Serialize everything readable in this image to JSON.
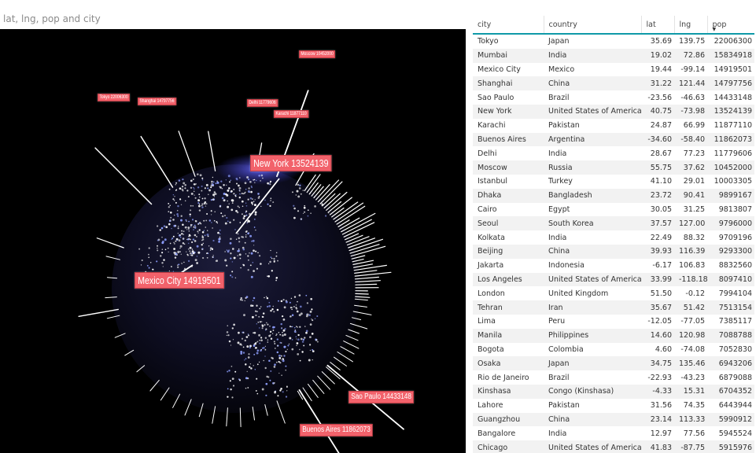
{
  "visual": {
    "title": "lat, lng, pop and city"
  },
  "globe": {
    "labels": [
      {
        "text": "Moscow 10452000",
        "size": "small"
      },
      {
        "text": "Tokyo 22006300",
        "size": "small"
      },
      {
        "text": "Shanghai 14797756",
        "size": "small"
      },
      {
        "text": "Delhi 11779606",
        "size": "small"
      },
      {
        "text": "Karachi 11877110",
        "size": "small"
      },
      {
        "text": "New York 13524139",
        "size": "large"
      },
      {
        "text": "Mexico City 14919501",
        "size": "large"
      },
      {
        "text": "Sao Paulo 14433148",
        "size": "medium"
      },
      {
        "text": "Buenos Aires 11862073",
        "size": "medium"
      }
    ]
  },
  "table": {
    "columns": [
      "city",
      "country",
      "lat",
      "lng",
      "pop"
    ],
    "sorted_column": "pop",
    "rows": [
      [
        "Tokyo",
        "Japan",
        "35.69",
        "139.75",
        "22006300"
      ],
      [
        "Mumbai",
        "India",
        "19.02",
        "72.86",
        "15834918"
      ],
      [
        "Mexico City",
        "Mexico",
        "19.44",
        "-99.14",
        "14919501"
      ],
      [
        "Shanghai",
        "China",
        "31.22",
        "121.44",
        "14797756"
      ],
      [
        "Sao Paulo",
        "Brazil",
        "-23.56",
        "-46.63",
        "14433148"
      ],
      [
        "New York",
        "United States of America",
        "40.75",
        "-73.98",
        "13524139"
      ],
      [
        "Karachi",
        "Pakistan",
        "24.87",
        "66.99",
        "11877110"
      ],
      [
        "Buenos Aires",
        "Argentina",
        "-34.60",
        "-58.40",
        "11862073"
      ],
      [
        "Delhi",
        "India",
        "28.67",
        "77.23",
        "11779606"
      ],
      [
        "Moscow",
        "Russia",
        "55.75",
        "37.62",
        "10452000"
      ],
      [
        "Istanbul",
        "Turkey",
        "41.10",
        "29.01",
        "10003305"
      ],
      [
        "Dhaka",
        "Bangladesh",
        "23.72",
        "90.41",
        "9899167"
      ],
      [
        "Cairo",
        "Egypt",
        "30.05",
        "31.25",
        "9813807"
      ],
      [
        "Seoul",
        "South Korea",
        "37.57",
        "127.00",
        "9796000"
      ],
      [
        "Kolkata",
        "India",
        "22.49",
        "88.32",
        "9709196"
      ],
      [
        "Beijing",
        "China",
        "39.93",
        "116.39",
        "9293300"
      ],
      [
        "Jakarta",
        "Indonesia",
        "-6.17",
        "106.83",
        "8832560"
      ],
      [
        "Los Angeles",
        "United States of America",
        "33.99",
        "-118.18",
        "8097410"
      ],
      [
        "London",
        "United Kingdom",
        "51.50",
        "-0.12",
        "7994104"
      ],
      [
        "Tehran",
        "Iran",
        "35.67",
        "51.42",
        "7513154"
      ],
      [
        "Lima",
        "Peru",
        "-12.05",
        "-77.05",
        "7385117"
      ],
      [
        "Manila",
        "Philippines",
        "14.60",
        "120.98",
        "7088788"
      ],
      [
        "Bogota",
        "Colombia",
        "4.60",
        "-74.08",
        "7052830"
      ],
      [
        "Osaka",
        "Japan",
        "34.75",
        "135.46",
        "6943206"
      ],
      [
        "Rio de Janeiro",
        "Brazil",
        "-22.93",
        "-43.23",
        "6879088"
      ],
      [
        "Kinshasa",
        "Congo (Kinshasa)",
        "-4.33",
        "15.31",
        "6704352"
      ],
      [
        "Lahore",
        "Pakistan",
        "31.56",
        "74.35",
        "6443944"
      ],
      [
        "Guangzhou",
        "China",
        "23.14",
        "113.33",
        "5990912"
      ],
      [
        "Bangalore",
        "India",
        "12.97",
        "77.56",
        "5945524"
      ],
      [
        "Chicago",
        "United States of America",
        "41.83",
        "-87.75",
        "5915976"
      ]
    ]
  }
}
